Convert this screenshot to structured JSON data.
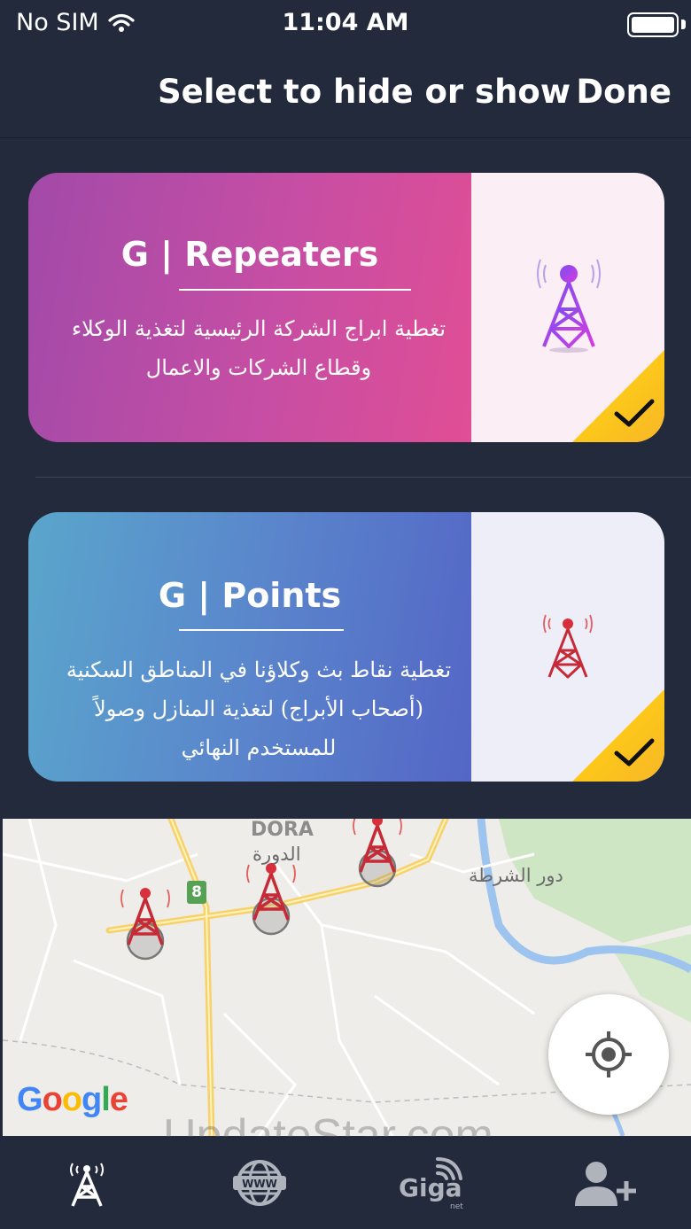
{
  "status_bar": {
    "carrier": "No SIM",
    "time": "11:04 AM"
  },
  "nav": {
    "title": "Select to hide or show",
    "done_label": "Done"
  },
  "cards": [
    {
      "title": "G | Repeaters",
      "description": "تغطية ابراج الشركة الرئيسية لتغذية الوكلاء وقطاع الشركات والاعمال",
      "icon": "tower-icon",
      "selected": true,
      "accent": "#c64ea4"
    },
    {
      "title": "G | Points",
      "description": "تغطية نقاط بث وكلاؤنا في المناطق السكنية (أصحاب الأبراج) لتغذية المنازل وصولاً للمستخدم النهائي",
      "icon": "tower-icon",
      "selected": true,
      "accent": "#5a86cc"
    }
  ],
  "map": {
    "area_label_en": "DORA",
    "area_label_ar": "الدورة",
    "place_label_ar": "دور الشرطة",
    "road_number": "8",
    "logo": "Google"
  },
  "watermark": "UpdateStar.com",
  "tabs": [
    {
      "icon": "tower-icon",
      "active": true
    },
    {
      "icon": "globe-www-icon",
      "active": false
    },
    {
      "icon": "giga-net-icon",
      "active": false
    },
    {
      "icon": "add-user-icon",
      "active": false
    }
  ]
}
